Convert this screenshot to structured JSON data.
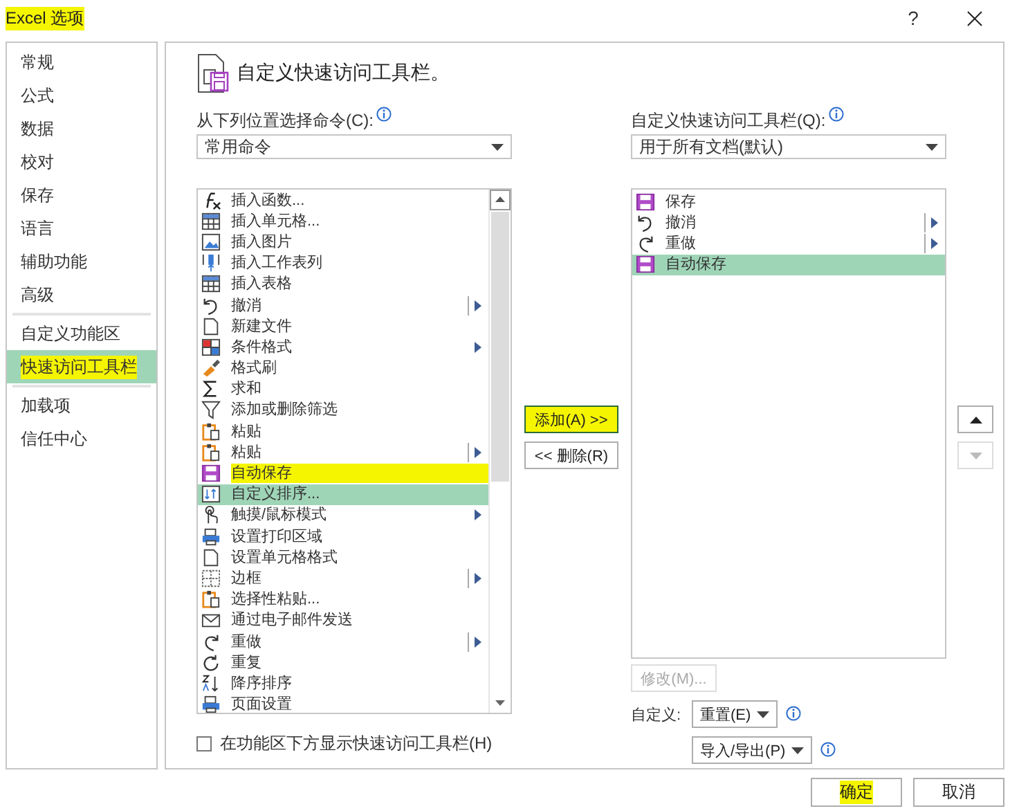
{
  "window": {
    "title": "Excel 选项",
    "highlighted": true,
    "help": "?"
  },
  "sidebar": {
    "groups": [
      [
        {
          "label": "常规",
          "selected": false,
          "highlighted": false
        },
        {
          "label": "公式",
          "selected": false,
          "highlighted": false
        },
        {
          "label": "数据",
          "selected": false,
          "highlighted": false
        },
        {
          "label": "校对",
          "selected": false,
          "highlighted": false
        },
        {
          "label": "保存",
          "selected": false,
          "highlighted": false
        },
        {
          "label": "语言",
          "selected": false,
          "highlighted": false
        },
        {
          "label": "辅助功能",
          "selected": false,
          "highlighted": false
        },
        {
          "label": "高级",
          "selected": false,
          "highlighted": false
        }
      ],
      [
        {
          "label": "自定义功能区",
          "selected": false,
          "highlighted": false
        },
        {
          "label": "快速访问工具栏",
          "selected": true,
          "highlighted": true
        }
      ],
      [
        {
          "label": "加载项",
          "selected": false,
          "highlighted": false
        },
        {
          "label": "信任中心",
          "selected": false,
          "highlighted": false
        }
      ]
    ]
  },
  "header": {
    "title": "自定义快速访问工具栏。"
  },
  "choose_from": {
    "label": "从下列位置选择命令(C):",
    "value": "常用命令"
  },
  "commands": [
    {
      "label": "插入函数...",
      "kind": "plain",
      "selected": false,
      "highlighted": false
    },
    {
      "label": "插入单元格...",
      "kind": "plain",
      "selected": false,
      "highlighted": false
    },
    {
      "label": "插入图片",
      "kind": "plain",
      "selected": false,
      "highlighted": false
    },
    {
      "label": "插入工作表列",
      "kind": "plain",
      "selected": false,
      "highlighted": false
    },
    {
      "label": "插入表格",
      "kind": "plain",
      "selected": false,
      "highlighted": false
    },
    {
      "label": "撤消",
      "kind": "split",
      "selected": false,
      "highlighted": false
    },
    {
      "label": "新建文件",
      "kind": "plain",
      "selected": false,
      "highlighted": false
    },
    {
      "label": "条件格式",
      "kind": "menu",
      "selected": false,
      "highlighted": false
    },
    {
      "label": "格式刷",
      "kind": "plain",
      "selected": false,
      "highlighted": false
    },
    {
      "label": "求和",
      "kind": "plain",
      "selected": false,
      "highlighted": false
    },
    {
      "label": "添加或删除筛选",
      "kind": "plain",
      "selected": false,
      "highlighted": false
    },
    {
      "label": "粘贴",
      "kind": "plain",
      "selected": false,
      "highlighted": false
    },
    {
      "label": "粘贴",
      "kind": "split",
      "selected": false,
      "highlighted": false
    },
    {
      "label": "自动保存",
      "kind": "plain",
      "selected": false,
      "highlighted": true
    },
    {
      "label": "自定义排序...",
      "kind": "plain",
      "selected": true,
      "highlighted": false
    },
    {
      "label": "触摸/鼠标模式",
      "kind": "menu",
      "selected": false,
      "highlighted": false
    },
    {
      "label": "设置打印区域",
      "kind": "plain",
      "selected": false,
      "highlighted": false
    },
    {
      "label": "设置单元格格式",
      "kind": "plain",
      "selected": false,
      "highlighted": false
    },
    {
      "label": "边框",
      "kind": "split",
      "selected": false,
      "highlighted": false
    },
    {
      "label": "选择性粘贴...",
      "kind": "plain",
      "selected": false,
      "highlighted": false
    },
    {
      "label": "通过电子邮件发送",
      "kind": "plain",
      "selected": false,
      "highlighted": false
    },
    {
      "label": "重做",
      "kind": "split",
      "selected": false,
      "highlighted": false
    },
    {
      "label": "重复",
      "kind": "plain",
      "selected": false,
      "highlighted": false
    },
    {
      "label": "降序排序",
      "kind": "plain",
      "selected": false,
      "highlighted": false
    },
    {
      "label": "页面设置",
      "kind": "plain",
      "selected": false,
      "highlighted": false
    }
  ],
  "add_button": {
    "label": "添加(A) >>",
    "highlighted": true
  },
  "remove_button": {
    "label": "<< 删除(R)"
  },
  "toolbar_for": {
    "label": "自定义快速访问工具栏(Q):",
    "value": "用于所有文档(默认)"
  },
  "toolbar_commands": [
    {
      "label": "保存",
      "kind": "plain",
      "selected": false
    },
    {
      "label": "撤消",
      "kind": "split",
      "selected": false
    },
    {
      "label": "重做",
      "kind": "split",
      "selected": false
    },
    {
      "label": "自动保存",
      "kind": "plain",
      "selected": true
    }
  ],
  "move_buttons": [
    {
      "kind": "up",
      "disabled": false
    },
    {
      "kind": "down",
      "disabled": true
    }
  ],
  "modify_button": {
    "label": "修改(M)...",
    "disabled": true
  },
  "customize": {
    "label": "自定义:",
    "reset": "重置(E)",
    "import_export": "导入/导出(P)"
  },
  "show_below": {
    "label": "在功能区下方显示快速访问工具栏(H)",
    "checked": false
  },
  "footer": {
    "ok": {
      "label": "确定",
      "highlighted": true
    },
    "cancel": {
      "label": "取消"
    }
  }
}
